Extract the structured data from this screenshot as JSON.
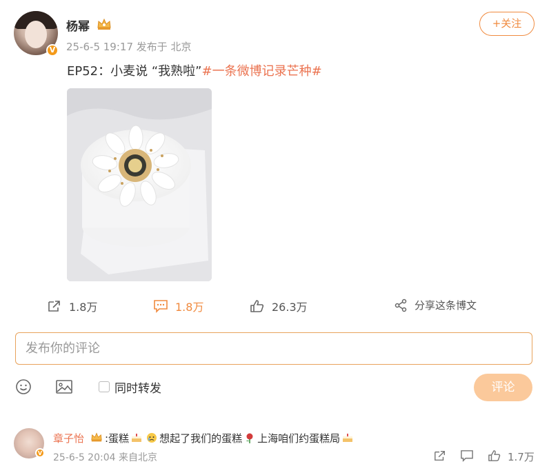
{
  "post": {
    "author": "杨幂",
    "meta": "25-6-5 19:17  发布于 北京",
    "follow_label": "+关注",
    "text_plain": "EP52：小麦说 “我熟啦”",
    "text_tag": "#一条微博记录芒种#",
    "image_desc_icon": "cake-photo",
    "verified_mark": "V"
  },
  "actions": {
    "share_count": "1.8万",
    "comment_count": "1.8万",
    "like_count": "26.3万",
    "forward_label": "分享这条博文"
  },
  "comment_box": {
    "placeholder": "发布你的评论",
    "sync_label": "同时转发",
    "submit_label": "评论"
  },
  "reply": {
    "author": "章子怡",
    "text_1": ":蛋糕",
    "text_2": "想起了我们的蛋糕",
    "text_3": "上海咱们约蛋糕局",
    "meta": "25-6-5 20:04  来自北京",
    "like_count": "1.7万",
    "verified_mark": "V"
  },
  "colors": {
    "accent": "#f08a3e",
    "tag": "#eb7350",
    "submit_bg": "#fbc99b",
    "verified": "#f49a1a"
  }
}
